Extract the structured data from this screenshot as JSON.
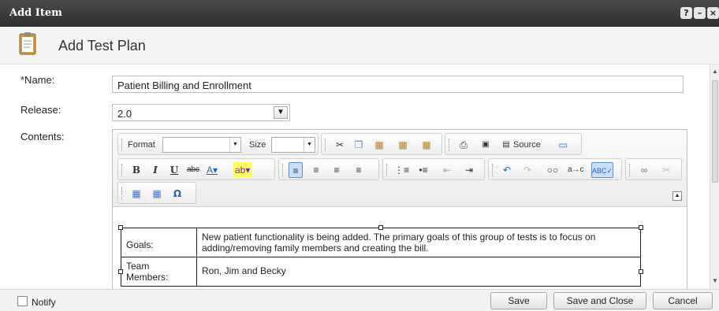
{
  "window": {
    "title": "Add Item",
    "controls": [
      "?",
      "–",
      "×"
    ]
  },
  "header": {
    "title": "Add Test Plan",
    "icon": "clipboard-icon"
  },
  "form": {
    "name_label": "*Name:",
    "name_value": "Patient Billing and Enrollment",
    "release_label": "Release:",
    "release_value": "2.0",
    "contents_label": "Contents:"
  },
  "toolbar": {
    "format_label": "Format",
    "size_label": "Size",
    "source_label": "Source",
    "bold": "B",
    "italic": "I",
    "underline": "U",
    "strike": "abc",
    "omega": "Ω"
  },
  "document": {
    "rows": [
      {
        "key": "Goals:",
        "value": "New patient functionality is being added.  The primary goals of this group of tests is to focus on adding/removing family members and creating the bill."
      },
      {
        "key": "Team Members:",
        "value": "Ron, Jim and Becky"
      }
    ]
  },
  "footer": {
    "notify_label": "Notify",
    "save_label": "Save",
    "save_close_label": "Save and Close",
    "cancel_label": "Cancel"
  },
  "colors": {
    "titlebar": "#3a3a3a",
    "active_button": "#c8defa"
  }
}
